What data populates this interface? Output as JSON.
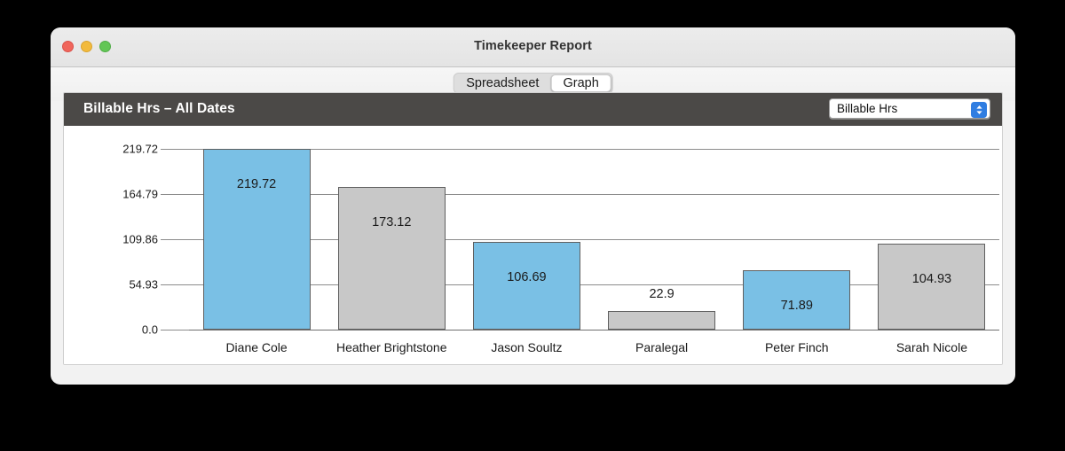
{
  "window": {
    "title": "Timekeeper Report",
    "traffic_lights": [
      {
        "name": "close",
        "color": "#f0655b"
      },
      {
        "name": "minimize",
        "color": "#f2ba3c"
      },
      {
        "name": "zoom",
        "color": "#62c655"
      }
    ]
  },
  "toolbar": {
    "segments": [
      {
        "label": "Spreadsheet",
        "active": false
      },
      {
        "label": "Graph",
        "active": true
      }
    ]
  },
  "panel": {
    "title": "Billable Hrs – All Dates",
    "header_color": "#4b4947",
    "popup": {
      "value": "Billable Hrs",
      "icon": "up-down-chevron-icon",
      "accent": "#2f7de1"
    }
  },
  "chart_data": {
    "type": "bar",
    "title": "Billable Hrs – All Dates",
    "xlabel": "",
    "ylabel": "",
    "categories": [
      "Diane Cole",
      "Heather Brightstone",
      "Jason Soultz",
      "Paralegal",
      "Peter Finch",
      "Sarah Nicole"
    ],
    "values": [
      219.72,
      173.12,
      106.69,
      22.9,
      71.89,
      104.93
    ],
    "value_labels": [
      "219.72",
      "173.12",
      "106.69",
      "22.9",
      "71.89",
      "104.93"
    ],
    "bar_colors": [
      "#7ac0e5",
      "#c8c8c8",
      "#7ac0e5",
      "#c8c8c8",
      "#7ac0e5",
      "#c8c8c8"
    ],
    "label_inside": [
      true,
      true,
      true,
      false,
      true,
      true
    ],
    "ytick_labels": [
      "0.0",
      "54.93",
      "109.86",
      "164.79",
      "219.72"
    ],
    "ytick_values": [
      0,
      54.93,
      109.86,
      164.79,
      219.72
    ],
    "ylim": [
      0,
      219.72
    ],
    "grid": true,
    "legend": "none"
  }
}
